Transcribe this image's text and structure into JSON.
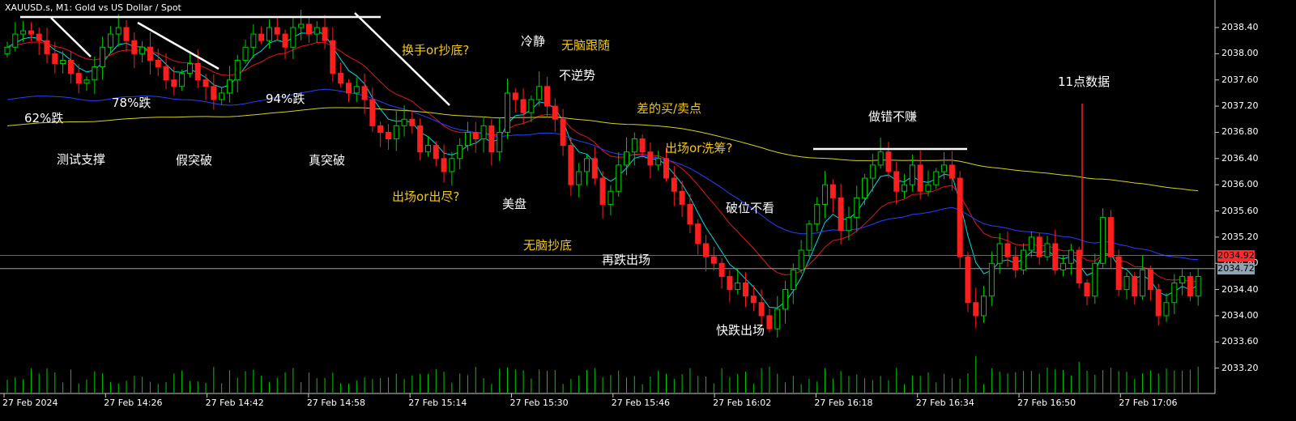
{
  "chart_data": {
    "type": "candlestick",
    "title": "XAUUSD.s, M1:  Gold vs US Dollar / Spot",
    "ylim": [
      2033.1,
      2038.6
    ],
    "yticks": [
      "2038.40",
      "2038.00",
      "2037.60",
      "2037.20",
      "2036.80",
      "2036.40",
      "2036.00",
      "2035.60",
      "2035.20",
      "2034.80",
      "2034.40",
      "2034.00",
      "2033.60",
      "2033.20"
    ],
    "xticks": [
      "27 Feb 2024",
      "27 Feb 14:26",
      "27 Feb 14:42",
      "27 Feb 14:58",
      "27 Feb 15:14",
      "27 Feb 15:30",
      "27 Feb 15:46",
      "27 Feb 16:02",
      "27 Feb 16:18",
      "27 Feb 16:34",
      "27 Feb 16:50",
      "27 Feb 17:06"
    ],
    "price_lines": [
      {
        "value": 2034.92,
        "label": "2034.92",
        "color": "#ff2a2a"
      },
      {
        "value": 2034.72,
        "label": "2034.72",
        "color": "#8fa3b0"
      }
    ],
    "annotations": [
      {
        "text": "62%跌",
        "color": "#ffffff"
      },
      {
        "text": "78%跌",
        "color": "#ffffff"
      },
      {
        "text": "94%跌",
        "color": "#ffffff"
      },
      {
        "text": "测试支撑",
        "color": "#ffffff"
      },
      {
        "text": "假突破",
        "color": "#ffffff"
      },
      {
        "text": "真突破",
        "color": "#ffffff"
      },
      {
        "text": "换手or抄底?",
        "color": "#f5c518"
      },
      {
        "text": "出场or出尽?",
        "color": "#f5c518"
      },
      {
        "text": "冷静",
        "color": "#ffffff"
      },
      {
        "text": "无脑跟随",
        "color": "#f5c518"
      },
      {
        "text": "不逆势",
        "color": "#ffffff"
      },
      {
        "text": "差的买/卖点",
        "color": "#f5c518"
      },
      {
        "text": "美盘",
        "color": "#ffffff"
      },
      {
        "text": "无脑抄底",
        "color": "#f5c518"
      },
      {
        "text": "再跌出场",
        "color": "#ffffff"
      },
      {
        "text": "出场or洗筹?",
        "color": "#f5c518"
      },
      {
        "text": "破位不看",
        "color": "#ffffff"
      },
      {
        "text": "快跌出场",
        "color": "#ffffff"
      },
      {
        "text": "做错不赚",
        "color": "#ffffff"
      },
      {
        "text": "11点数据",
        "color": "#ffffff"
      }
    ],
    "series": [
      {
        "kind": "candles",
        "up_color": "#00c800",
        "down_color": "#ff1e1e",
        "closes": [
          2038.1,
          2038.3,
          2038.35,
          2038.3,
          2038.2,
          2038.0,
          2037.85,
          2037.9,
          2037.7,
          2037.55,
          2037.6,
          2037.8,
          2038.1,
          2038.3,
          2038.4,
          2038.2,
          2038.0,
          2038.1,
          2037.9,
          2037.8,
          2037.6,
          2037.5,
          2037.7,
          2037.85,
          2037.6,
          2037.5,
          2037.3,
          2037.4,
          2037.6,
          2037.9,
          2038.1,
          2038.3,
          2038.2,
          2038.4,
          2038.3,
          2038.1,
          2038.4,
          2038.45,
          2038.3,
          2038.4,
          2038.2,
          2037.7,
          2037.55,
          2037.4,
          2037.5,
          2037.3,
          2036.9,
          2036.8,
          2036.7,
          2036.9,
          2037.0,
          2036.9,
          2036.5,
          2036.6,
          2036.4,
          2036.2,
          2036.4,
          2036.6,
          2036.8,
          2036.7,
          2036.9,
          2036.5,
          2036.8,
          2037.4,
          2037.3,
          2037.1,
          2037.3,
          2037.5,
          2037.2,
          2037.0,
          2036.6,
          2036.0,
          2036.2,
          2036.4,
          2036.1,
          2035.7,
          2035.9,
          2036.3,
          2036.5,
          2036.7,
          2036.5,
          2036.3,
          2036.4,
          2036.1,
          2035.9,
          2035.7,
          2035.4,
          2035.1,
          2034.9,
          2034.8,
          2034.6,
          2034.4,
          2034.5,
          2034.3,
          2034.2,
          2034.0,
          2033.8,
          2034.1,
          2034.4,
          2034.7,
          2035.0,
          2035.4,
          2035.7,
          2036.0,
          2035.8,
          2035.3,
          2035.5,
          2035.8,
          2036.1,
          2036.3,
          2036.5,
          2036.2,
          2035.9,
          2036.0,
          2036.3,
          2035.9,
          2036.0,
          2036.2,
          2036.3,
          2036.1,
          2034.9,
          2034.2,
          2034.0,
          2034.3,
          2034.8,
          2035.1,
          2034.9,
          2034.7,
          2035.0,
          2035.2,
          2034.9,
          2035.1,
          2034.7,
          2034.8,
          2035.0,
          2034.5,
          2034.3,
          2034.8,
          2035.5,
          2034.9,
          2034.4,
          2034.6,
          2034.3,
          2034.7,
          2034.4,
          2034.0,
          2034.2,
          2034.5,
          2034.6,
          2034.3,
          2034.6
        ]
      },
      {
        "kind": "line",
        "name": "",
        "color": "#00d8e0"
      },
      {
        "kind": "line",
        "name": "",
        "color": "#e01818"
      },
      {
        "kind": "line",
        "name": "",
        "color": "#2840ff"
      },
      {
        "kind": "line",
        "name": "",
        "color": "#d8d020"
      }
    ]
  }
}
